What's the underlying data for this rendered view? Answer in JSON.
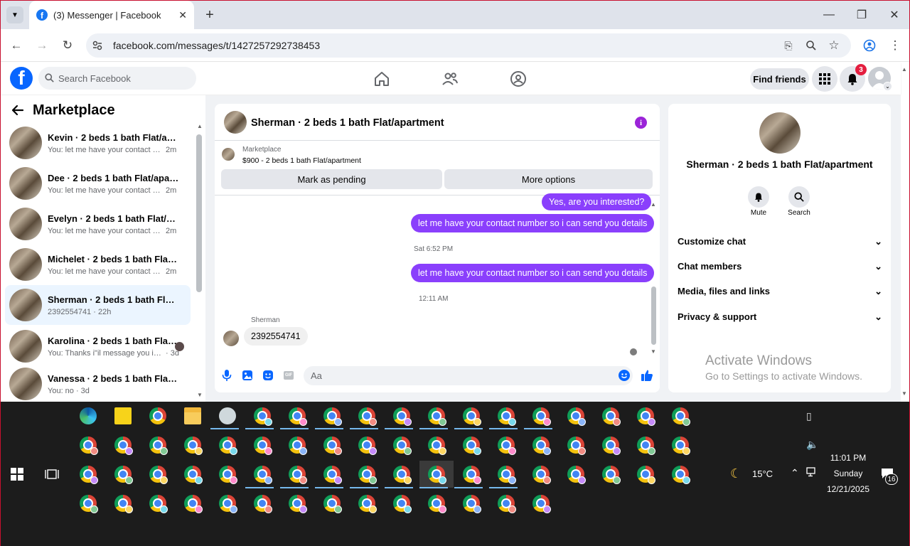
{
  "browser": {
    "tab_title": "(3) Messenger | Facebook",
    "tab_favicon": "f",
    "url": "facebook.com/messages/t/1427257292738453"
  },
  "fb": {
    "logo": "f",
    "search_placeholder": "Search Facebook",
    "find_friends": "Find friends",
    "notification_count": "3"
  },
  "sidebar": {
    "title": "Marketplace",
    "conversations": [
      {
        "name": "Kevin · 2 beds 1 bath Flat/apart...",
        "preview": "You: let me have your contact nu...",
        "time": "2m"
      },
      {
        "name": "Dee · 2 beds 1 bath Flat/apartm...",
        "preview": "You: let me have your contact nu...",
        "time": "2m"
      },
      {
        "name": "Evelyn · 2 beds 1 bath Flat/apart...",
        "preview": "You: let me have your contact nu...",
        "time": "2m"
      },
      {
        "name": "Michelet · 2 beds 1 bath Flat/ap...",
        "preview": "You: let me have your contact nu...",
        "time": "2m"
      },
      {
        "name": "Sherman · 2 beds 1 bath Flat/ap...",
        "preview": "2392554741 · 22h",
        "time": ""
      },
      {
        "name": "Karolina · 2 beds 1 bath Flat/a...",
        "preview": "You: Thanks i\"il message you in ...",
        "time": "· 3d"
      },
      {
        "name": "Vanessa · 2 beds 1 bath Flat/apa...",
        "preview": "You: no · 3d",
        "time": ""
      }
    ]
  },
  "chat": {
    "header_title": "Sherman · 2 beds 1 bath Flat/apartment",
    "listing_source": "Marketplace",
    "listing_detail": "$900 - 2 beds 1 bath Flat/apartment",
    "mark_pending": "Mark as pending",
    "more_options": "More options",
    "msg1": "Yes, are you interested?",
    "msg2": "let me have your contact number so i can send you details",
    "stamp1": "Sat 6:52 PM",
    "msg3": "let me have your contact number so i can send you details",
    "stamp2": "12:11 AM",
    "sender_name": "Sherman",
    "msg4": "2392554741",
    "composer_placeholder": "Aa"
  },
  "info": {
    "name": "Sherman · 2 beds 1 bath Flat/apartment",
    "mute": "Mute",
    "search": "Search",
    "sections": [
      "Customize chat",
      "Chat members",
      "Media, files and links",
      "Privacy & support"
    ]
  },
  "watermark": {
    "line1": "Activate Windows",
    "line2": "Go to Settings to activate Windows."
  },
  "taskbar": {
    "weather": "15°C",
    "time": "11:01 PM",
    "day": "Sunday",
    "date": "12/21/2025",
    "notif_count": "16"
  }
}
